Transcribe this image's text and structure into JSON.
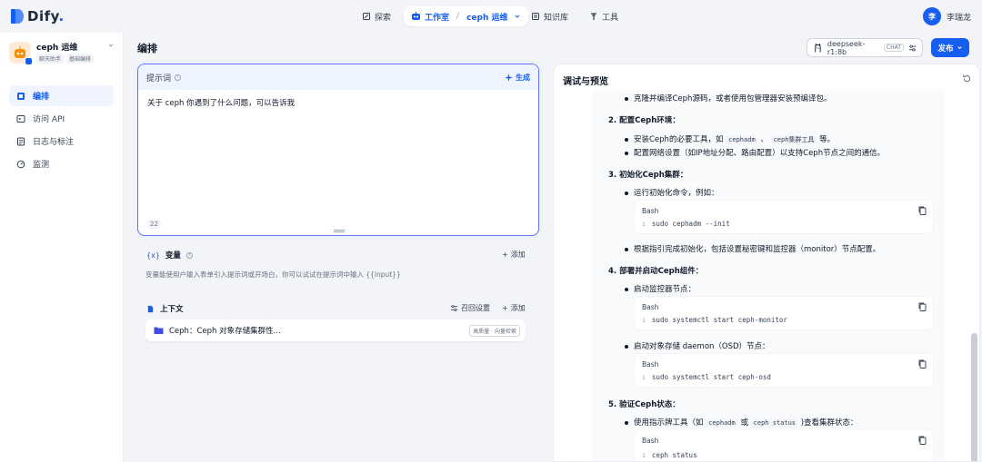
{
  "app": {
    "brand": "Dify",
    "user_initial": "李",
    "user_name": "李瑞龙"
  },
  "topnav": {
    "explore": "探索",
    "studio": "工作室",
    "current_app": "ceph 运维",
    "knowledge": "知识库",
    "tools": "工具"
  },
  "sidebar": {
    "app_name": "ceph 运维",
    "tags": [
      "聊天助手",
      "基础编排"
    ],
    "items": [
      {
        "label": "编排",
        "icon": "orchestrate-icon",
        "active": true
      },
      {
        "label": "访问 API",
        "icon": "terminal-icon",
        "active": false
      },
      {
        "label": "日志与标注",
        "icon": "file-list-icon",
        "active": false
      },
      {
        "label": "监测",
        "icon": "dashboard-icon",
        "active": false
      }
    ]
  },
  "main": {
    "title": "编排",
    "model_name": "deepseek-r1:8b",
    "model_mode": "CHAT",
    "publish_label": "发布"
  },
  "prompt": {
    "title": "提示词",
    "generate_label": "生成",
    "text": "关于 ceph 你遇到了什么问题，可以告诉我",
    "count": "22"
  },
  "variables": {
    "title": "变量",
    "add_label": "添加",
    "description": "变量能使用户输入表单引入提示词或开场白，你可以试试在提示词中输入 {{input}}"
  },
  "context": {
    "title": "上下文",
    "recall_label": "召回设置",
    "add_label": "添加",
    "dataset_name": "Ceph：Ceph 对象存储集群性...",
    "dataset_badge": "高质量 · 向量检索"
  },
  "debug": {
    "title": "调试与预览",
    "content": {
      "b1": "克隆并编译Ceph源码，或者使用包管理器安装预编译包。",
      "s2": "2. 配置Ceph环境：",
      "b2a_pre": "安装Ceph的必要工具，如",
      "b2a_code1": "cephadm",
      "b2a_mid": "、",
      "b2a_code2": "ceph集群工具",
      "b2a_post": "等。",
      "b2b": "配置网络设置（如IP地址分配、路由配置）以支持Ceph节点之间的通信。",
      "s3": "3. 初始化Ceph集群：",
      "b3a": "运行初始化命令，例如：",
      "code1_lang": "Bash",
      "code1_ln": "1",
      "code1_text": "sudo cephadm --init",
      "b3b": "根据指引完成初始化，包括设置秘密键和监控器（monitor）节点配置。",
      "s4": "4. 部署并启动Ceph组件：",
      "b4a": "启动监控器节点：",
      "code2_lang": "Bash",
      "code2_ln": "1",
      "code2_text": "sudo systemctl start ceph-monitor",
      "b4b": "启动对象存储 daemon（OSD）节点：",
      "code3_lang": "Bash",
      "code3_ln": "1",
      "code3_text": "sudo systemctl start ceph-osd",
      "s5": "5. 验证Ceph状态：",
      "b5a_pre": "使用指示牌工具（如",
      "b5a_code1": "cephadm",
      "b5a_mid": "或",
      "b5a_code2": "ceph status",
      "b5a_post": ")查看集群状态：",
      "code4_lang": "Bash",
      "code4_ln": "1",
      "code4_text": "ceph status"
    }
  },
  "colors": {
    "accent": "#155eef",
    "prompt_border": "#6172f3",
    "prompt_header": "#eef4ff",
    "background": "#f2f4f7"
  }
}
